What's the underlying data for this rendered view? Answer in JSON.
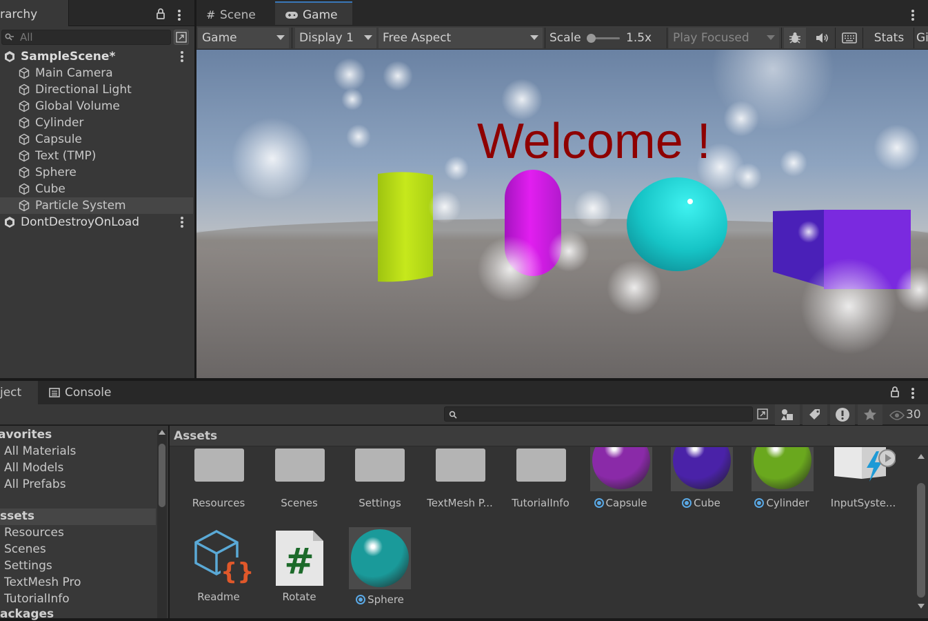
{
  "hierarchy": {
    "tab_label": "rarchy",
    "search_placeholder": "All",
    "scene_name": "SampleScene*",
    "items": [
      "Main Camera",
      "Directional Light",
      "Global Volume",
      "Cylinder",
      "Capsule",
      "Text (TMP)",
      "Sphere",
      "Cube",
      "Particle System"
    ],
    "ddol_name": "DontDestroyOnLoad"
  },
  "game": {
    "tabs": [
      {
        "label": "Scene",
        "icon": "hash-icon"
      },
      {
        "label": "Game",
        "icon": "gamepad-icon"
      }
    ],
    "toolbar": {
      "view_select": "Game",
      "display": "Display 1",
      "aspect": "Free Aspect",
      "scale_label": "Scale",
      "scale_value": "1.5x",
      "play_mode": "Play Focused",
      "stats": "Stats",
      "gizmos": "Giz"
    },
    "welcome_text": "Welcome !"
  },
  "project": {
    "tabs": [
      {
        "label": "ject",
        "icon": "folder-icon"
      },
      {
        "label": "Console",
        "icon": "console-icon"
      }
    ],
    "hidden_count": "30",
    "favorites_header": "avorites",
    "favorites": [
      "All Materials",
      "All Models",
      "All Prefabs"
    ],
    "assets_header": "ssets",
    "asset_folders": [
      "Resources",
      "Scenes",
      "Settings",
      "TextMesh Pro",
      "TutorialInfo"
    ],
    "packages_header": "ackages",
    "breadcrumb": "Assets",
    "grid": [
      {
        "name": "Resources",
        "kind": "folder"
      },
      {
        "name": "Scenes",
        "kind": "folder"
      },
      {
        "name": "Settings",
        "kind": "folder"
      },
      {
        "name": "TextMesh P...",
        "kind": "folder"
      },
      {
        "name": "TutorialInfo",
        "kind": "folder"
      },
      {
        "name": "Capsule",
        "kind": "material",
        "color": "#8a2aa8"
      },
      {
        "name": "Cube",
        "kind": "material",
        "color": "#4a22a8"
      },
      {
        "name": "Cylinder",
        "kind": "material",
        "color": "#6aa81e"
      },
      {
        "name": "InputSyste...",
        "kind": "input-actions"
      },
      {
        "name": "Readme",
        "kind": "readme"
      },
      {
        "name": "Rotate",
        "kind": "script"
      },
      {
        "name": "Sphere",
        "kind": "material",
        "color": "#1a9a9a"
      }
    ]
  }
}
